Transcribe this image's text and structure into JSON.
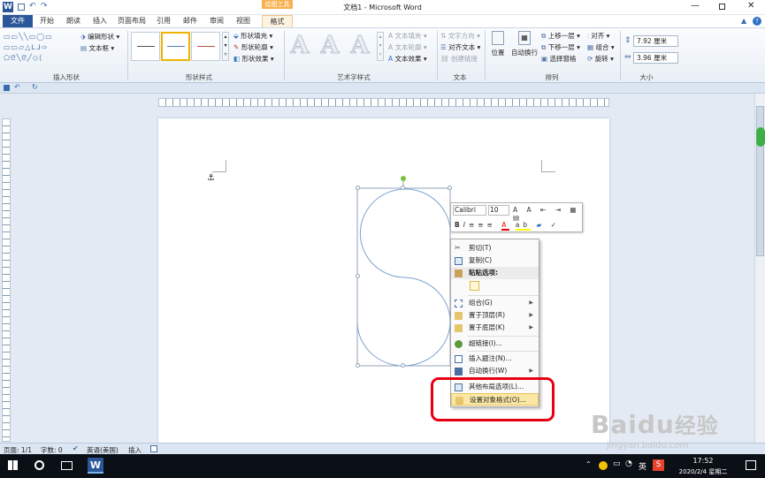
{
  "window": {
    "title": "文档1 - Microsoft Word",
    "app_icon": "word-icon",
    "contextual_tab": "绘图工具"
  },
  "tabs": [
    "文件",
    "开始",
    "朗读",
    "插入",
    "页面布局",
    "引用",
    "邮件",
    "审阅",
    "视图",
    "格式"
  ],
  "ribbon": {
    "insert_shapes": {
      "label": "插入形状",
      "edit_shape": "编辑形状",
      "text_box": "文本框"
    },
    "shape_styles": {
      "label": "形状样式",
      "fill": "形状填充",
      "outline": "形状轮廓",
      "effects": "形状效果"
    },
    "wordart": {
      "label": "艺术字样式",
      "letter": "A",
      "text_fill": "文本填充",
      "text_outline": "文本轮廓",
      "text_effects": "文本效果"
    },
    "text": {
      "label": "文本",
      "direction": "文字方向",
      "align": "对齐文本",
      "link": "创建链接"
    },
    "arrange": {
      "label": "排列",
      "position": "位置",
      "wrap": "自动换行",
      "bring_forward": "上移一层",
      "send_backward": "下移一层",
      "pane": "选择窗格",
      "align": "对齐",
      "group": "组合",
      "rotate": "旋转"
    },
    "size": {
      "label": "大小",
      "height": "7.92 厘米",
      "width": "3.96 厘米"
    }
  },
  "mini_toolbar": {
    "font": "Calibri",
    "size": "10"
  },
  "context_menu": {
    "items": [
      "剪切(T)",
      "复制(C)",
      "粘贴选项:",
      "组合(G)",
      "置于顶层(R)",
      "置于底层(K)",
      "超链接(I)...",
      "插入题注(N)...",
      "自动换行(W)",
      "其他布局选项(L)...",
      "设置对象格式(O)..."
    ]
  },
  "status": {
    "page": "页面: 1/1",
    "words": "字数: 0",
    "lang": "英语(美国)",
    "mode": "插入"
  },
  "taskbar": {
    "time": "17:52",
    "date": "2020/2/4 星期二",
    "ime": "英"
  },
  "watermark": {
    "brand": "Baidu",
    "cn": "经验",
    "url": "jingyan.baidu.com"
  },
  "colors": {
    "file_tab": "#2b579a",
    "highlight": "#fbe8a6",
    "red_box": "#e60012",
    "taskbar": "#0b0f16"
  }
}
